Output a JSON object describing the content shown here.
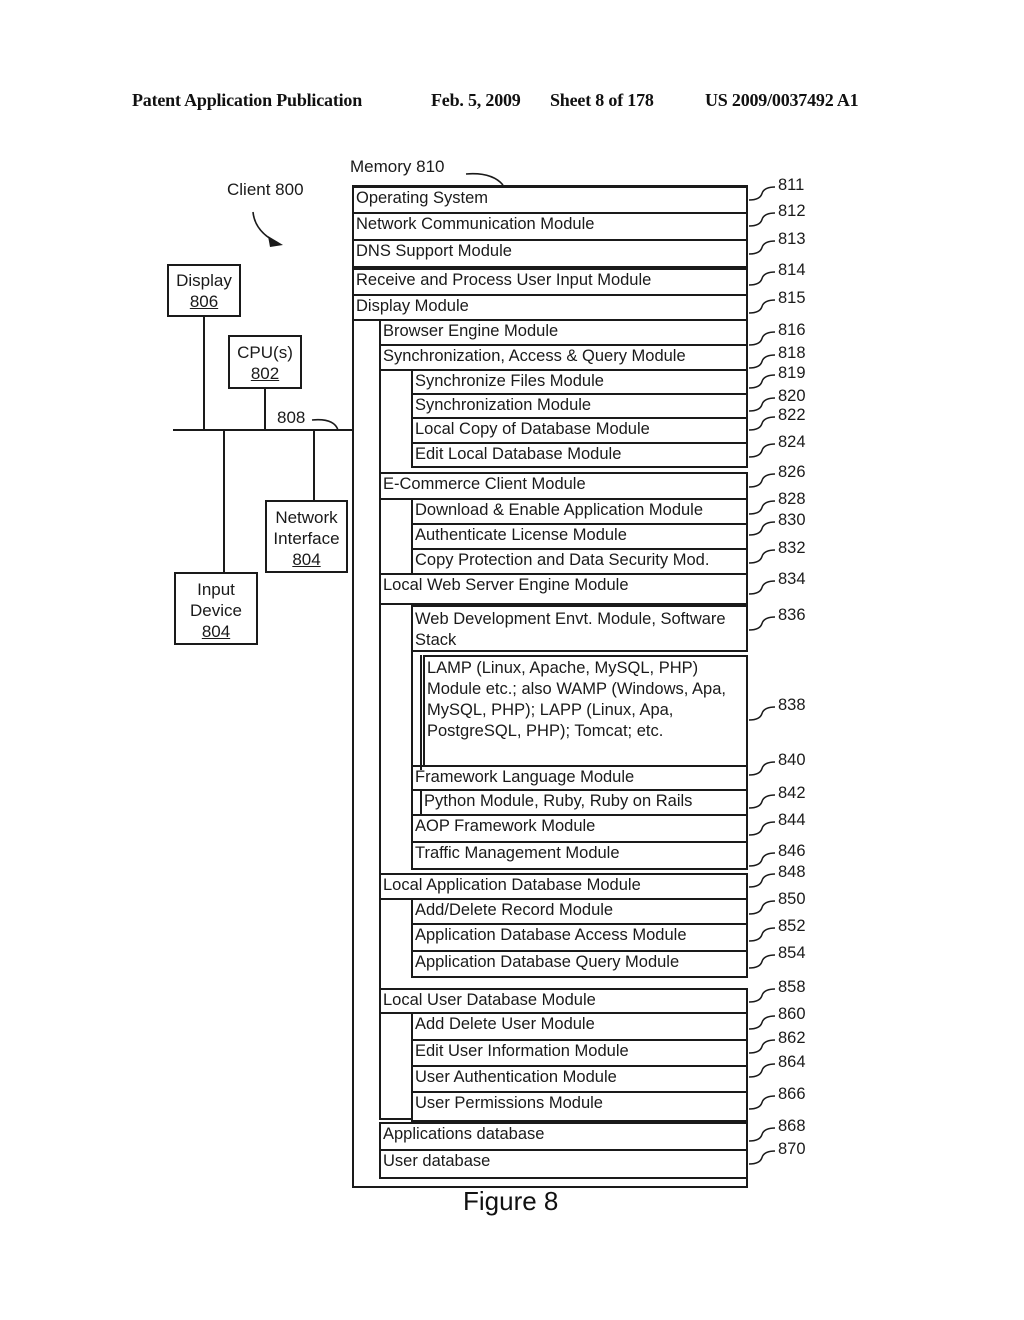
{
  "header": {
    "publication": "Patent Application Publication",
    "date": "Feb. 5, 2009",
    "sheet": "Sheet 8 of 178",
    "number": "US 2009/0037492 A1"
  },
  "figure": {
    "caption": "Figure 8",
    "client_label": "Client 800",
    "memory_label": "Memory 810",
    "bus_label": "808",
    "components": {
      "display": {
        "name": "Display",
        "ref": "806"
      },
      "cpu": {
        "name": "CPU(s)",
        "ref": "802"
      },
      "network": {
        "name_line1": "Network",
        "name_line2": "Interface",
        "ref": "804"
      },
      "input": {
        "name_line1": "Input",
        "name_line2": "Device",
        "ref": "804"
      }
    },
    "memory_modules": [
      {
        "label": "Operating System",
        "ref": "811",
        "level": 0
      },
      {
        "label": "Network Communication Module",
        "ref": "812",
        "level": 0
      },
      {
        "label": "DNS Support Module",
        "ref": "813",
        "level": 0
      },
      {
        "label": "Receive and Process User Input Module",
        "ref": "814",
        "level": 0
      },
      {
        "label": "Display Module",
        "ref": "815",
        "level": 0
      },
      {
        "label": "Browser Engine Module",
        "ref": "816",
        "level": 1
      },
      {
        "label": "Synchronization, Access & Query Module",
        "ref": "818",
        "level": 1
      },
      {
        "label": "Synchronize Files Module",
        "ref": "819",
        "level": 2
      },
      {
        "label": "Synchronization Module",
        "ref": "820",
        "level": 2
      },
      {
        "label": "Local Copy of Database Module",
        "ref": "822",
        "level": 2
      },
      {
        "label": "Edit Local Database Module",
        "ref": "824",
        "level": 2
      },
      {
        "label": "E-Commerce Client Module",
        "ref": "826",
        "level": 1
      },
      {
        "label": "Download & Enable Application Module",
        "ref": "828",
        "level": 2
      },
      {
        "label": "Authenticate License Module",
        "ref": "830",
        "level": 2
      },
      {
        "label": "Copy Protection and Data Security Mod.",
        "ref": "832",
        "level": 2
      },
      {
        "label": "Local Web Server Engine Module",
        "ref": "834",
        "level": 1
      },
      {
        "label": "Web Development Envt. Module, Software Stack",
        "ref": "836",
        "level": 2
      },
      {
        "label": "LAMP (Linux, Apache, MySQL, PHP) Module etc.; also WAMP (Windows, Apa, MySQL, PHP); LAPP (Linux, Apa, PostgreSQL, PHP); Tomcat; etc.",
        "ref": "838",
        "level": 3
      },
      {
        "label": "Framework Language Module",
        "ref": "840",
        "level": 2
      },
      {
        "label": "Python Module, Ruby, Ruby on Rails",
        "ref": "842",
        "level": 3
      },
      {
        "label": "AOP Framework Module",
        "ref": "844",
        "level": 2
      },
      {
        "label": "Traffic Management Module",
        "ref": "846",
        "level": 2
      },
      {
        "label": "Local Application Database Module",
        "ref": "848",
        "level": 1
      },
      {
        "label": "Add/Delete Record Module",
        "ref": "850",
        "level": 2
      },
      {
        "label": "Application Database Access Module",
        "ref": "852",
        "level": 2
      },
      {
        "label": "Application Database Query Module",
        "ref": "854",
        "level": 2
      },
      {
        "label": "Local User Database Module",
        "ref": "858",
        "level": 1
      },
      {
        "label": "Add Delete User Module",
        "ref": "860",
        "level": 2
      },
      {
        "label": "Edit User Information Module",
        "ref": "862",
        "level": 2
      },
      {
        "label": "User Authentication Module",
        "ref": "864",
        "level": 2
      },
      {
        "label": "User Permissions Module",
        "ref": "866",
        "level": 2
      },
      {
        "label": "Applications database",
        "ref": "868",
        "level": 1
      },
      {
        "label": "User database",
        "ref": "870",
        "level": 1
      }
    ]
  }
}
